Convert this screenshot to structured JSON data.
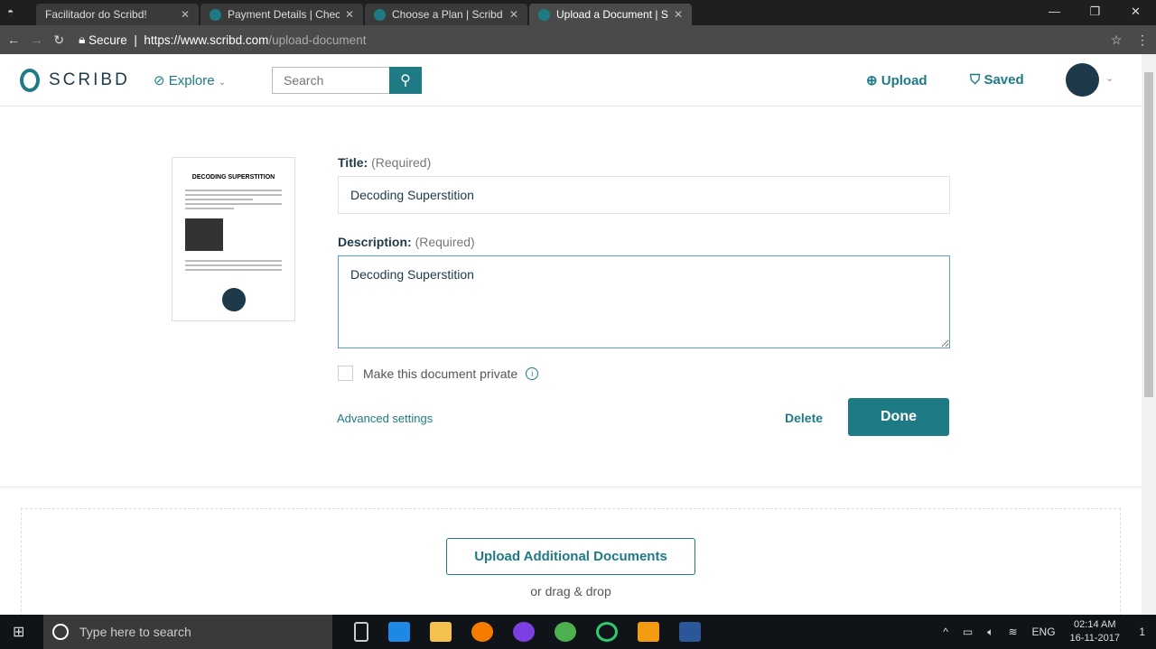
{
  "browser": {
    "tabs": [
      {
        "title": "Facilitador do Scribd!",
        "active": false
      },
      {
        "title": "Payment Details | Checko",
        "active": false
      },
      {
        "title": "Choose a Plan | Scribd",
        "active": false
      },
      {
        "title": "Upload a Document | Scr",
        "active": true
      }
    ],
    "secure_label": "Secure",
    "url_host": "https://www.scribd.com",
    "url_path": "/upload-document"
  },
  "header": {
    "logo": "SCRIBD",
    "explore": "Explore",
    "search_placeholder": "Search",
    "upload": "Upload",
    "saved": "Saved"
  },
  "doc": {
    "thumb_title": "DECODING SUPERSTITION"
  },
  "form": {
    "title_label": "Title:",
    "title_req": "(Required)",
    "title_value": "Decoding Superstition",
    "desc_label": "Description:",
    "desc_req": "(Required)",
    "desc_value": "Decoding Superstition",
    "private_label": "Make this document private",
    "private_checked": false,
    "advanced": "Advanced settings",
    "delete": "Delete",
    "done": "Done"
  },
  "upload": {
    "button": "Upload Additional Documents",
    "drag": "or drag & drop"
  },
  "taskbar": {
    "search_placeholder": "Type here to search",
    "lang": "ENG",
    "time": "02:14 AM",
    "date": "16-11-2017",
    "notifications": "1"
  },
  "colors": {
    "accent": "#1e7b85",
    "dark": "#1e3a4a"
  }
}
